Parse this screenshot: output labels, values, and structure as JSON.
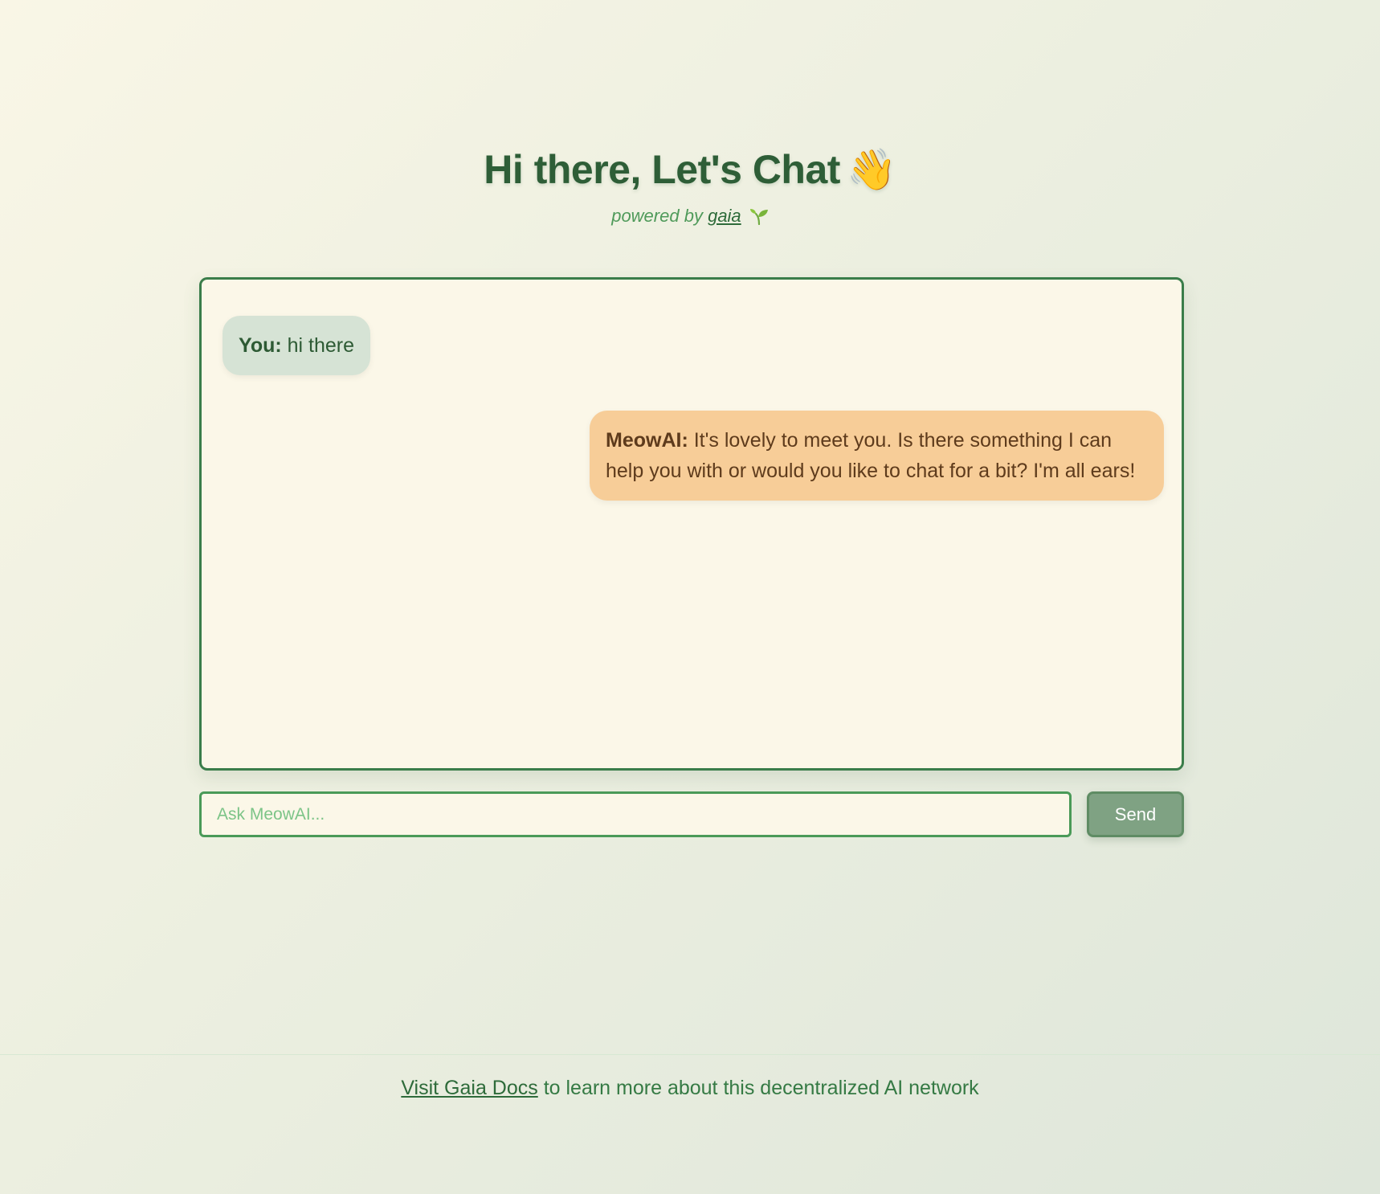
{
  "header": {
    "title": "Hi there, Let's Chat",
    "title_emoji": "👋",
    "powered_by": "powered by",
    "brand_link": "gaia",
    "brand_icon": "🌱"
  },
  "chat": {
    "messages": [
      {
        "role": "user",
        "speaker": "You:",
        "text": "hi there"
      },
      {
        "role": "assistant",
        "speaker": "MeowAI:",
        "text": "It's lovely to meet you. Is there something I can help you with or would you like to chat for a bit? I'm all ears!"
      }
    ]
  },
  "composer": {
    "placeholder": "Ask MeowAI...",
    "value": "",
    "send_label": "Send"
  },
  "footer": {
    "link_text": "Visit Gaia Docs",
    "rest_text": "to learn more about this decentralized AI network"
  },
  "colors": {
    "primary_green": "#2e5e37",
    "border_green": "#3a7d4a",
    "user_bubble": "#d6e3d5",
    "ai_bubble": "#f7cd98",
    "send_button": "#7fa283",
    "panel_bg": "#fbf7e8"
  }
}
